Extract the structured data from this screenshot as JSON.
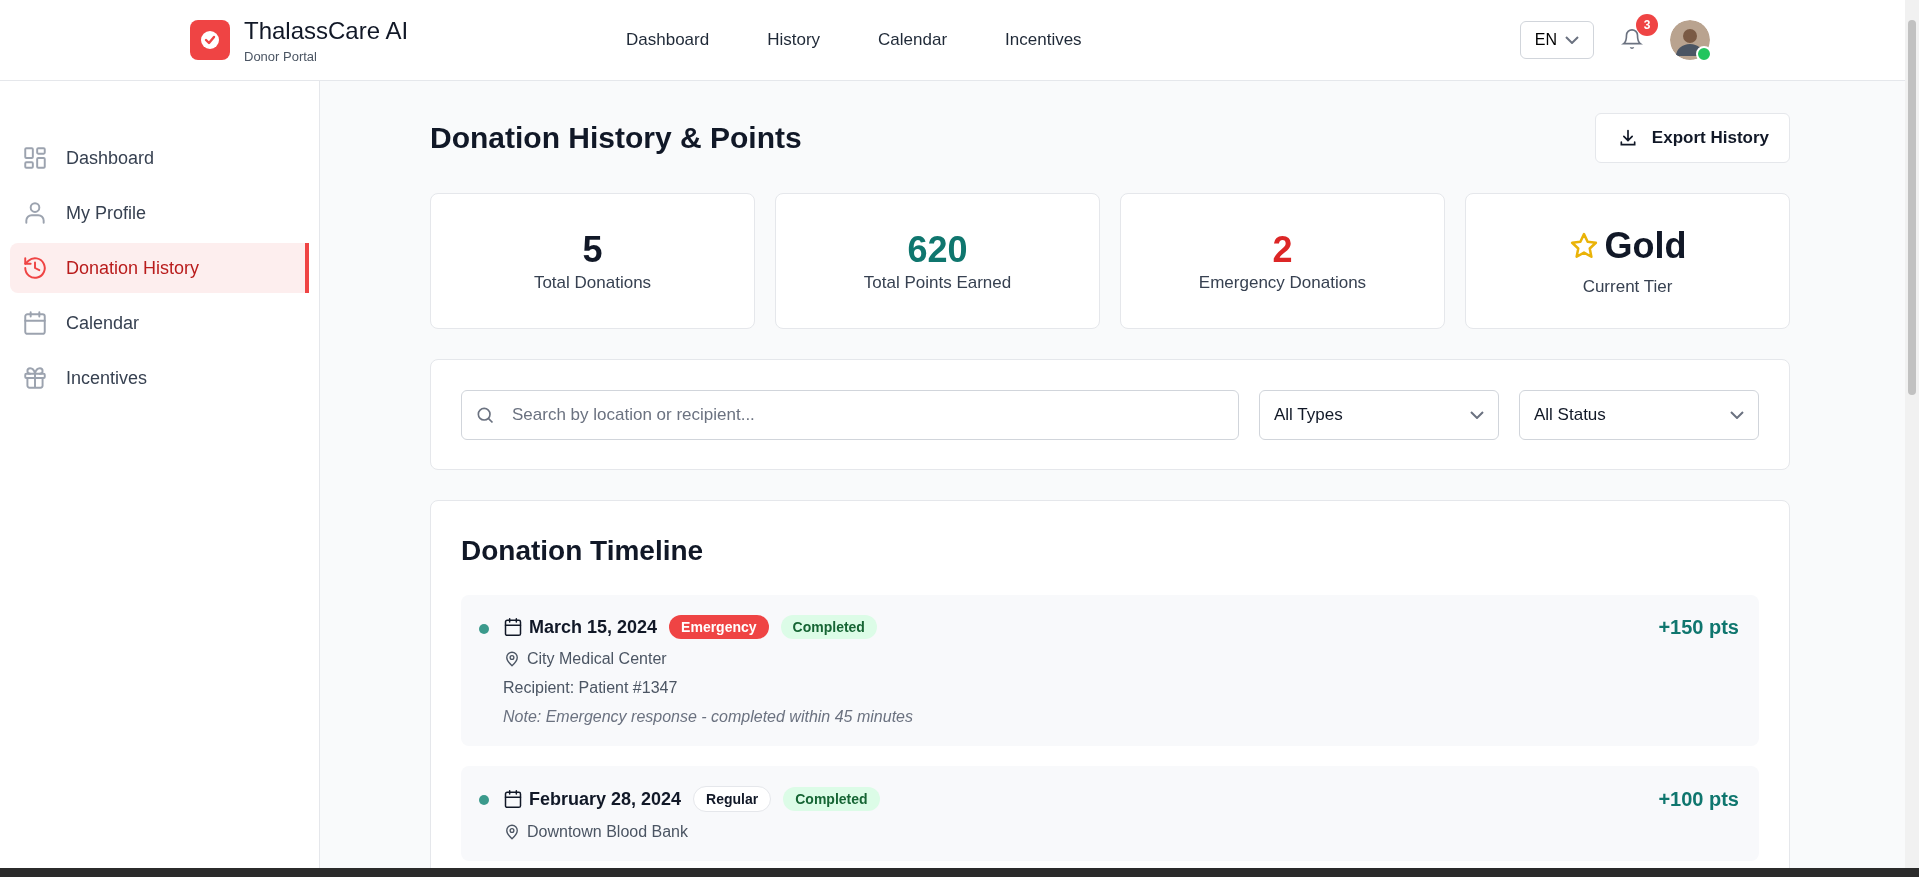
{
  "header": {
    "app_name": "ThalassCare AI",
    "subtitle": "Donor Portal",
    "nav": [
      {
        "label": "Dashboard",
        "selected": false
      },
      {
        "label": "History",
        "selected": false
      },
      {
        "label": "Calendar",
        "selected": false
      },
      {
        "label": "Incentives",
        "selected": false
      }
    ],
    "language": "EN",
    "notification_count": "3",
    "user_online": true
  },
  "sidebar": {
    "items": [
      {
        "label": "Dashboard",
        "selected": false
      },
      {
        "label": "My Profile",
        "selected": false
      },
      {
        "label": "Donation History",
        "selected": true
      },
      {
        "label": "Calendar",
        "selected": false
      },
      {
        "label": "Incentives",
        "selected": false
      }
    ]
  },
  "page_title": "Donation History & Points",
  "export_button": "Export History",
  "stats": [
    {
      "value": "5",
      "label": "Total Donations",
      "color": "#111827",
      "kind": "count"
    },
    {
      "value": "620",
      "label": "Total Points Earned",
      "color": "#0f766e",
      "kind": "count"
    },
    {
      "value": "2",
      "label": "Emergency Donations",
      "color": "#dc2626",
      "kind": "count"
    },
    {
      "value": "Gold",
      "label": "Current Tier",
      "color": "#111827",
      "kind": "tier"
    }
  ],
  "filters": {
    "search": {
      "placeholder": "Search by location or recipient..."
    },
    "selects": [
      "All Types",
      "All Status"
    ]
  },
  "timeline": {
    "title": "Donation Timeline",
    "entries": [
      {
        "date": "March 15, 2024",
        "type": {
          "label": "Emergency",
          "kind": "emergency"
        },
        "status": "Completed",
        "points": "+150 pts",
        "location": "City Medical Center",
        "recipient": "Recipient: Patient #1347",
        "note": "Note: Emergency response - completed within 45 minutes"
      },
      {
        "date": "February 28, 2024",
        "type": {
          "label": "Regular",
          "kind": "regular"
        },
        "status": "Completed",
        "points": "+100 pts",
        "location": "Downtown Blood Bank"
      }
    ]
  }
}
